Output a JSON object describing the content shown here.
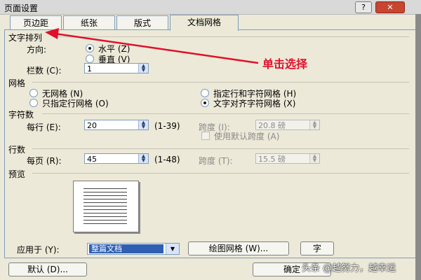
{
  "window": {
    "title": "页面设置",
    "help_glyph": "?",
    "close_glyph": "✕"
  },
  "tabs": [
    {
      "label": "页边距"
    },
    {
      "label": "纸张"
    },
    {
      "label": "版式"
    },
    {
      "label": "文档网格"
    }
  ],
  "text_direction": {
    "heading": "文字排列",
    "direction_label": "方向:",
    "options": [
      {
        "label": "水平 (Z)",
        "checked": true
      },
      {
        "label": "垂直 (V)",
        "checked": false
      }
    ],
    "columns_label": "栏数 (C):",
    "columns_value": "1"
  },
  "grid": {
    "heading": "网格",
    "options": [
      {
        "label": "无网格 (N)",
        "checked": false
      },
      {
        "label": "只指定行网格 (O)",
        "checked": false
      },
      {
        "label": "指定行和字符网格 (H)",
        "checked": false
      },
      {
        "label": "文字对齐字符网格 (X)",
        "checked": true
      }
    ]
  },
  "chars": {
    "heading": "字符数",
    "per_line_label": "每行 (E):",
    "per_line_value": "20",
    "per_line_range": "(1-39)",
    "pitch_label": "跨度 (I):",
    "pitch_value": "20.8 磅",
    "default_pitch_label": "使用默认跨度 (A)"
  },
  "lines": {
    "heading": "行数",
    "per_page_label": "每页 (R):",
    "per_page_value": "45",
    "per_page_range": "(1-48)",
    "pitch_label": "跨度 (T):",
    "pitch_value": "15.5 磅"
  },
  "preview": {
    "heading": "预览"
  },
  "apply": {
    "label": "应用于 (Y):",
    "value": "整篇文档",
    "drawing_grid_button": "绘图网格 (W)...",
    "font_button": "字"
  },
  "footer": {
    "default_button": "默认 (D)...",
    "ok_button": "确定"
  },
  "annotation": "单击选择",
  "watermark": "头条 @越努力，越幸运",
  "colors": {
    "annotation": "#e0102b",
    "selection": "#2f5fb3"
  }
}
